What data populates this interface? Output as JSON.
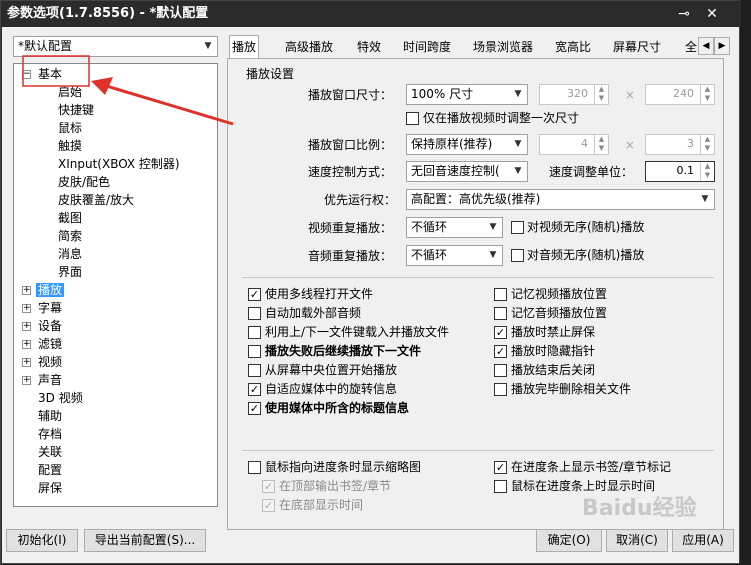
{
  "window": {
    "title": "参数选项(1.7.8556) - *默认配置"
  },
  "profile_combo": "*默认配置",
  "tree": [
    {
      "label": "基本",
      "expanded": true,
      "children": [
        "启始",
        "快捷键",
        "鼠标",
        "触摸",
        "XInput(XBOX 控制器)",
        "皮肤/配色",
        "皮肤覆盖/放大",
        "截图",
        "简索",
        "消息",
        "界面"
      ]
    },
    {
      "label": "播放",
      "collapsed": true,
      "selected": true
    },
    {
      "label": "字幕",
      "collapsed": true
    },
    {
      "label": "设备",
      "collapsed": true
    },
    {
      "label": "滤镜",
      "collapsed": true
    },
    {
      "label": "视频",
      "collapsed": true
    },
    {
      "label": "声音",
      "collapsed": true
    },
    {
      "label": "3D 视频"
    },
    {
      "label": "辅助"
    },
    {
      "label": "存档"
    },
    {
      "label": "关联"
    },
    {
      "label": "配置"
    },
    {
      "label": "屏保"
    }
  ],
  "tabs": [
    "播放",
    "高级播放",
    "特效",
    "时间跨度",
    "场景浏览器",
    "宽高比",
    "屏幕尺寸",
    "全"
  ],
  "playback": {
    "group_title": "播放设置",
    "window_size_label": "播放窗口尺寸：",
    "window_size_value": "100% 尺寸",
    "width": "320",
    "height": "240",
    "times": "×",
    "adjust_once": "仅在播放视频时调整一次尺寸",
    "ratio_label": "播放窗口比例：",
    "ratio_value": "保持原样(推荐)",
    "ratio_w": "4",
    "ratio_h": "3",
    "speed_mode_label": "速度控制方式：",
    "speed_mode_value": "无回音速度控制(",
    "speed_unit_label": "速度调整单位：",
    "speed_unit_value": "0.1",
    "priority_label": "优先运行权：",
    "priority_value": "高配置：高优先级(推荐)",
    "video_repeat_label": "视频重复播放：",
    "video_repeat_value": "不循环",
    "video_random": "对视频无序(随机)播放",
    "audio_repeat_label": "音频重复播放：",
    "audio_repeat_value": "不循环",
    "audio_random": "对音频无序(随机)播放"
  },
  "options_left": [
    {
      "label": "使用多线程打开文件",
      "checked": true,
      "bold": false
    },
    {
      "label": "自动加载外部音频",
      "checked": false,
      "bold": false
    },
    {
      "label": "利用上/下一文件键载入并播放文件",
      "checked": false,
      "bold": false
    },
    {
      "label": "播放失败后继续播放下一文件",
      "checked": false,
      "bold": true
    },
    {
      "label": "从屏幕中央位置开始播放",
      "checked": false,
      "bold": false
    },
    {
      "label": "自适应媒体中的旋转信息",
      "checked": true,
      "bold": false
    },
    {
      "label": "使用媒体中所含的标题信息",
      "checked": true,
      "bold": true
    }
  ],
  "options_right": [
    {
      "label": "记忆视频播放位置",
      "checked": false
    },
    {
      "label": "记忆音频播放位置",
      "checked": false
    },
    {
      "label": "播放时禁止屏保",
      "checked": true
    },
    {
      "label": "播放时隐藏指针",
      "checked": true
    },
    {
      "label": "播放结束后关闭",
      "checked": false
    },
    {
      "label": "播放完毕删除相关文件",
      "checked": false
    }
  ],
  "progress_opts": {
    "thumb": "鼠标指向进度条时显示缩略图",
    "top_out": "在顶部输出书签/章节",
    "bottom_show": "在底部显示时间",
    "show_marks": "在进度条上显示书签/章节标记",
    "show_time": "鼠标在进度条上时显示时间"
  },
  "buttons": {
    "init": "初始化(I)",
    "export": "导出当前配置(S)...",
    "ok": "确定(O)",
    "cancel": "取消(C)",
    "apply": "应用(A)"
  },
  "watermark": "Baidu经验"
}
